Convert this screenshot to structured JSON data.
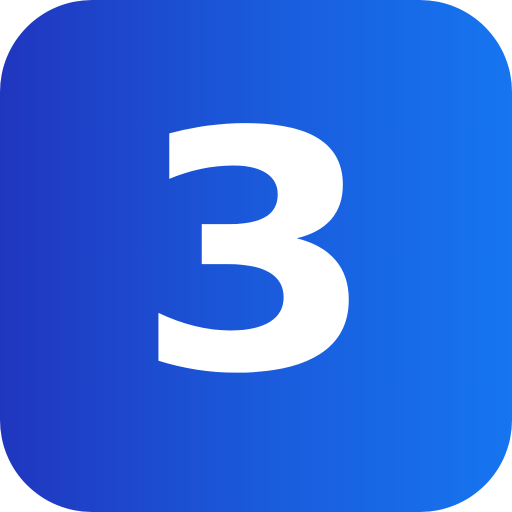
{
  "icon": {
    "label": "3",
    "shape": "rounded-square",
    "colors": {
      "gradient_start": "#2036bf",
      "gradient_end": "#1675f0",
      "digit": "#ffffff"
    }
  }
}
